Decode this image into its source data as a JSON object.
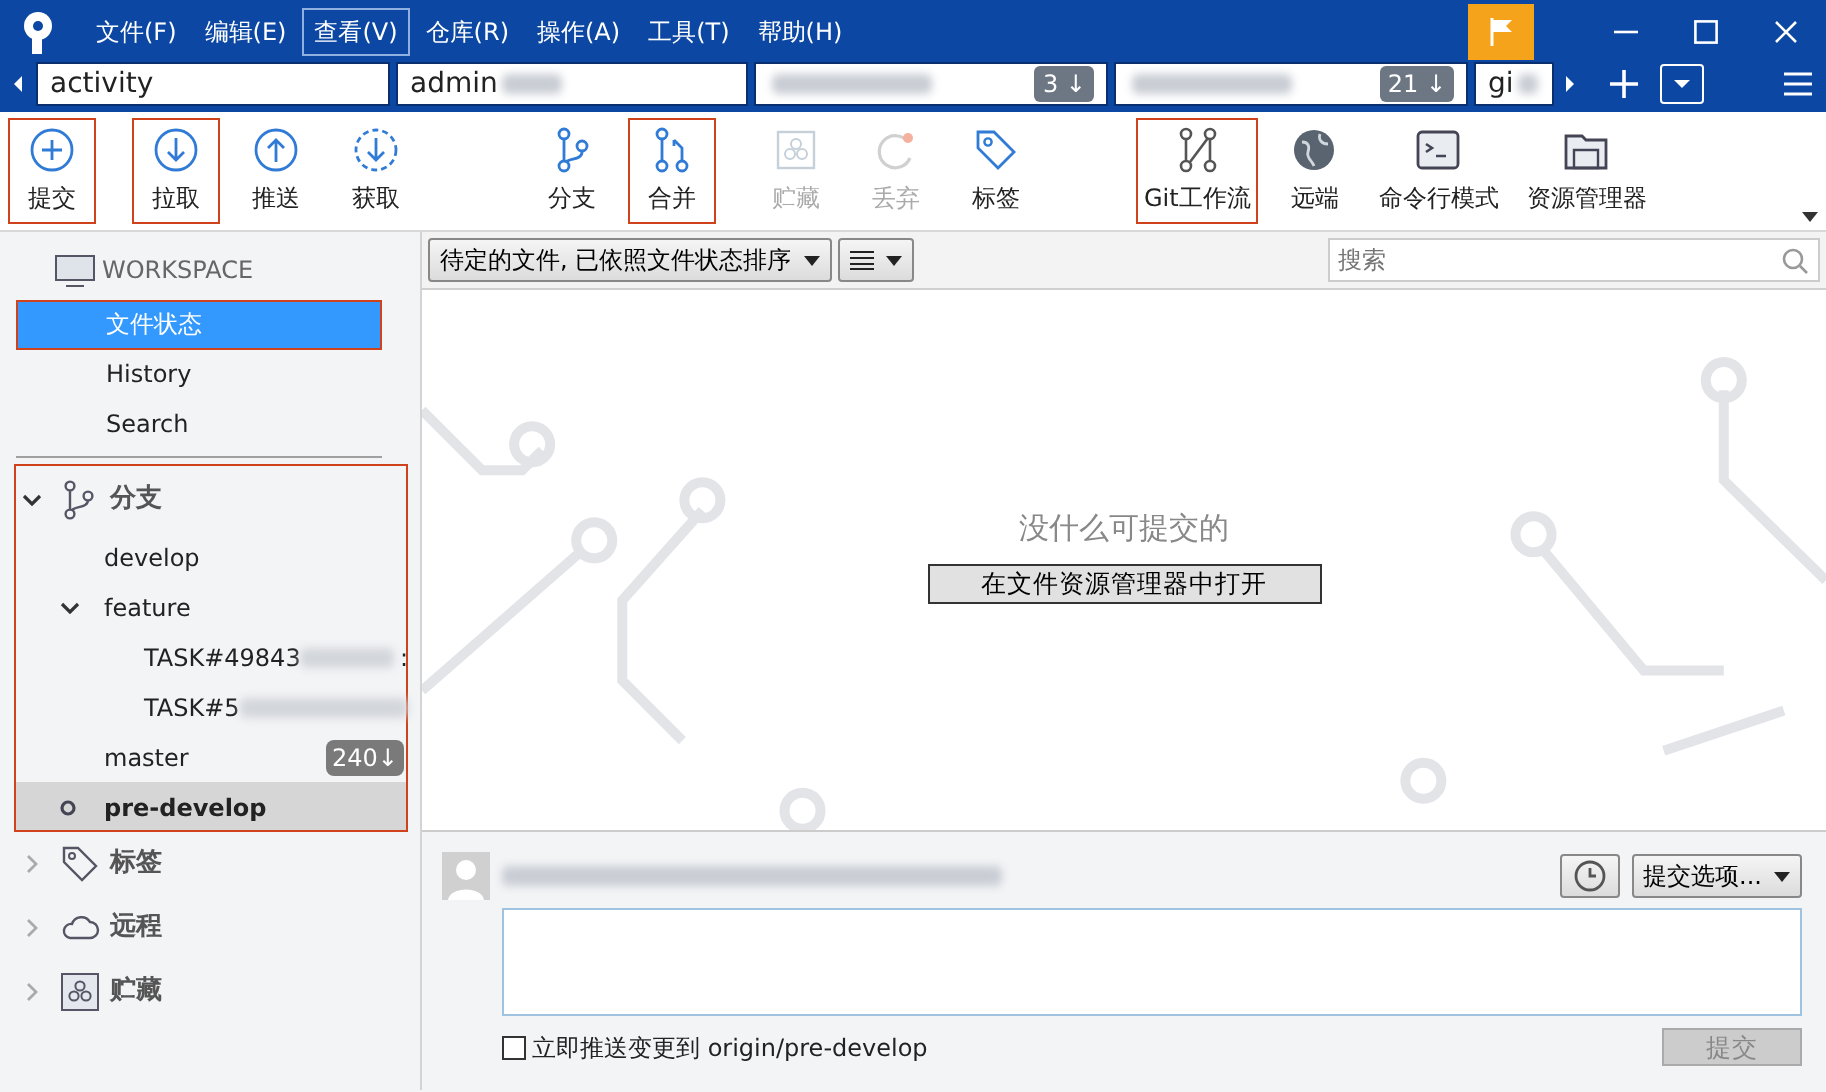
{
  "menu": [
    {
      "label": "文件(F)",
      "selected": false
    },
    {
      "label": "编辑(E)",
      "selected": false
    },
    {
      "label": "查看(V)",
      "selected": true
    },
    {
      "label": "仓库(R)",
      "selected": false
    },
    {
      "label": "操作(A)",
      "selected": false
    },
    {
      "label": "工具(T)",
      "selected": false
    },
    {
      "label": "帮助(H)",
      "selected": false
    }
  ],
  "repo_tabs": [
    {
      "label": "activity",
      "redacted": false
    },
    {
      "label": "admin",
      "redacted": true
    },
    {
      "redacted": true,
      "count": "3 ↓"
    },
    {
      "redacted": true,
      "count": "21 ↓"
    },
    {
      "label": "gi",
      "redacted": true
    }
  ],
  "toolbar": [
    [
      {
        "label": "提交",
        "disabled": false,
        "highlighted": true
      }
    ],
    [
      {
        "label": "拉取",
        "disabled": false,
        "highlighted": true
      },
      {
        "label": "推送",
        "disabled": false,
        "highlighted": false
      },
      {
        "label": "获取",
        "disabled": false,
        "highlighted": false
      }
    ],
    [
      {
        "label": "分支",
        "disabled": false,
        "highlighted": false
      },
      {
        "label": "合并",
        "disabled": false,
        "highlighted": true
      }
    ],
    [
      {
        "label": "贮藏",
        "disabled": true,
        "highlighted": false
      },
      {
        "label": "丢弃",
        "disabled": true,
        "highlighted": false
      },
      {
        "label": "标签",
        "disabled": false,
        "highlighted": false
      }
    ],
    [
      {
        "label": "Git工作流",
        "disabled": false,
        "highlighted": true
      },
      {
        "label": "远端",
        "disabled": false,
        "highlighted": false
      },
      {
        "label": "命令行模式",
        "disabled": false,
        "highlighted": false
      },
      {
        "label": "资源管理器",
        "disabled": false,
        "highlighted": false
      }
    ]
  ],
  "sidebar": {
    "workspace": {
      "title": "WORKSPACE",
      "items": [
        {
          "label": "文件状态",
          "selected": true,
          "highlighted": true
        },
        {
          "label": "History",
          "selected": false,
          "highlighted": false
        },
        {
          "label": "Search",
          "selected": false,
          "highlighted": false
        }
      ]
    },
    "sections": [
      {
        "title": "分支",
        "expanded": true,
        "highlighted": true,
        "children": [
          {
            "label": "develop",
            "current": false
          },
          {
            "label": "feature",
            "current": false,
            "expanded": true,
            "children": [
              {
                "label": "TASK#49843",
                "current": false,
                "redacted": true,
                "suffix": ":"
              },
              {
                "label": "TASK#5",
                "current": false,
                "redacted": true
              }
            ]
          },
          {
            "label": "master",
            "current": false,
            "badge": "240↓"
          },
          {
            "label": "pre-develop",
            "current": true
          }
        ]
      },
      {
        "title": "标签",
        "expanded": false,
        "highlighted": false
      },
      {
        "title": "远程",
        "expanded": false,
        "highlighted": false
      },
      {
        "title": "贮藏",
        "expanded": false,
        "highlighted": false
      }
    ]
  },
  "filter_bar": {
    "sort": "待定的文件, 已依照文件状态排序",
    "search": {
      "placeholder": "搜索"
    }
  },
  "empty_state": {
    "message": "没什么可提交的",
    "button": "在文件资源管理器中打开"
  },
  "commit": {
    "options": "提交选项...",
    "push_option": {
      "label": "立即推送变更到 origin/pre-develop",
      "checked": false
    },
    "button": {
      "label": "提交",
      "disabled": true
    }
  }
}
